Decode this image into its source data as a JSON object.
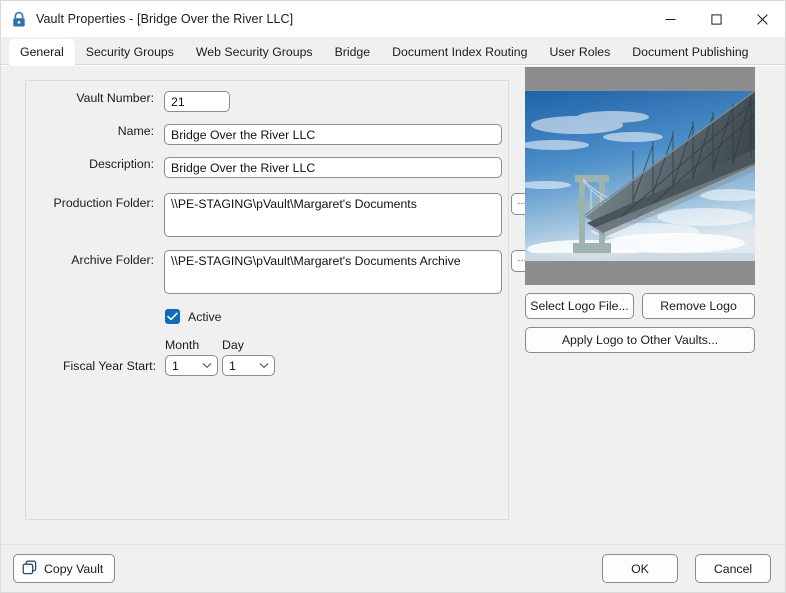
{
  "window": {
    "title": "Vault Properties - [Bridge Over the River LLC]",
    "icon": "lock-icon",
    "controls": {
      "minimize": "—",
      "maximize": "□",
      "close": "✕"
    }
  },
  "tabs": [
    {
      "label": "General",
      "active": true
    },
    {
      "label": "Security Groups",
      "active": false
    },
    {
      "label": "Web Security Groups",
      "active": false
    },
    {
      "label": "Bridge",
      "active": false
    },
    {
      "label": "Document Index Routing",
      "active": false
    },
    {
      "label": "User Roles",
      "active": false
    },
    {
      "label": "Document Publishing",
      "active": false
    }
  ],
  "general": {
    "vault_number": {
      "label": "Vault Number:",
      "value": "21"
    },
    "name": {
      "label": "Name:",
      "value": "Bridge Over the River LLC"
    },
    "description": {
      "label": "Description:",
      "value": "Bridge Over the River LLC"
    },
    "production_folder": {
      "label": "Production Folder:",
      "value": "\\\\PE-STAGING\\pVault\\Margaret's Documents",
      "browse_label": "..."
    },
    "archive_folder": {
      "label": "Archive Folder:",
      "value": "\\\\PE-STAGING\\pVault\\Margaret's Documents Archive",
      "browse_label": "..."
    },
    "active": {
      "label": "Active",
      "checked": true
    },
    "fiscal_year_start": {
      "label": "Fiscal Year Start:",
      "month_header": "Month",
      "day_header": "Day",
      "month_value": "1",
      "day_value": "1"
    }
  },
  "logo": {
    "alt": "bridge-photo",
    "select_label": "Select Logo File...",
    "remove_label": "Remove Logo",
    "apply_label": "Apply Logo to Other Vaults..."
  },
  "footer": {
    "copy_label": "Copy Vault",
    "ok_label": "OK",
    "cancel_label": "Cancel"
  },
  "colors": {
    "accent": "#0f6cbd",
    "window_bg": "#f0f0f0",
    "titlebar_bg": "#ffffff",
    "field_border": "#8b8b8b",
    "panel_border": "#dcdcdc",
    "logo_letterbox": "#8d8d8d",
    "sky": "#2e74b5"
  }
}
